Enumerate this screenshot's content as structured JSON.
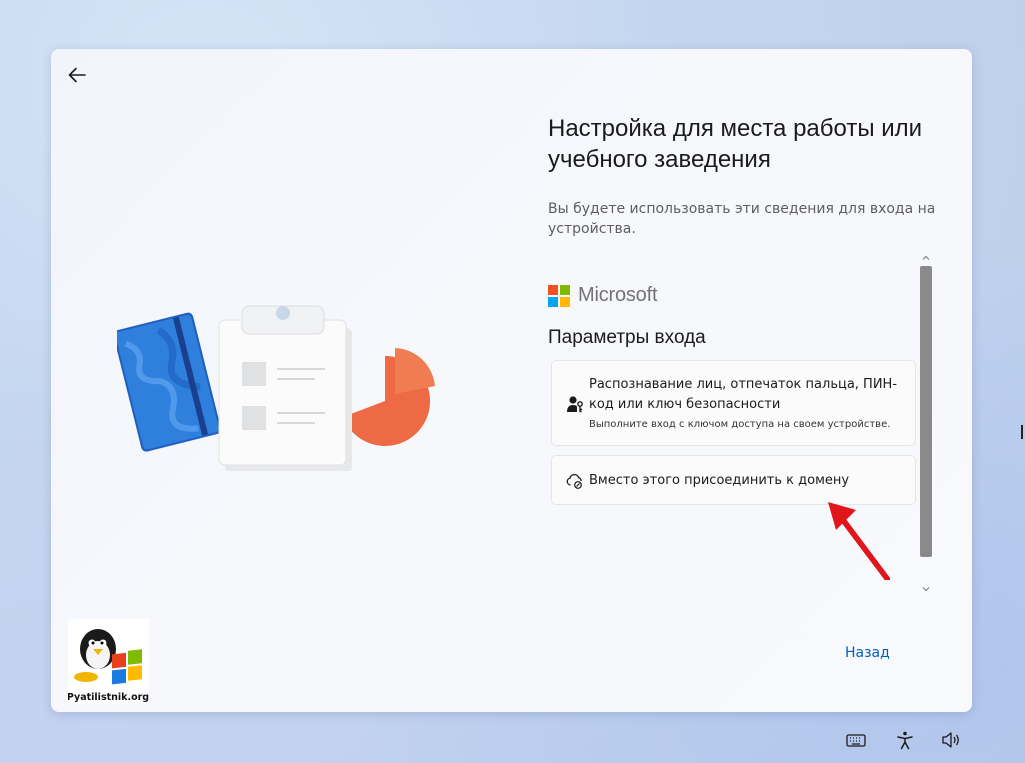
{
  "window": {
    "title": "Настройка для места работы или учебного заведения",
    "subtitle": "Вы будете использовать эти сведения для входа на устройства."
  },
  "brand": {
    "name": "Microsoft",
    "colors": [
      "#f25022",
      "#7fba00",
      "#00a4ef",
      "#ffb900"
    ]
  },
  "signin": {
    "section_title": "Параметры входа",
    "options": [
      {
        "icon": "person-key-icon",
        "title": "Распознавание лиц, отпечаток пальца, ПИН-код или ключ безопасности",
        "description": "Выполните вход с ключом доступа на своем устройстве."
      },
      {
        "icon": "domain-join-icon",
        "title": "Вместо этого присоединить к домену"
      }
    ]
  },
  "footer": {
    "back_label": "Назад"
  },
  "watermark": {
    "text": "Pyatilistnik.org"
  },
  "accent": {
    "link": "#005fb8",
    "annotation_arrow": "#e0161b"
  },
  "icons": {
    "back": "back-arrow-icon",
    "keyboard": "keyboard-icon",
    "accessibility": "accessibility-icon",
    "volume": "volume-icon"
  }
}
